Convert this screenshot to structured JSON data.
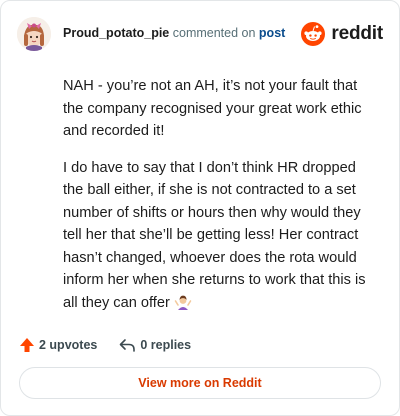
{
  "header": {
    "username": "Proud_potato_pie",
    "action_text": "commented on",
    "post_link": "post",
    "brand_word": "reddit"
  },
  "comment": {
    "paragraph_1": "NAH - you’re not an AH, it’s not your fault that the company recognised your great work ethic and recorded it!",
    "paragraph_2": "I do have to say that I don’t think HR dropped the ball either, if she is not contracted to a set number of shifts or hours then why would they tell her that she’ll be getting less! Her contract hasn’t changed, whoever does the rota would inform her when she returns to work that this is all they can offer"
  },
  "actions": {
    "upvotes": "2 upvotes",
    "replies": "0 replies"
  },
  "footer": {
    "view_more": "View more on Reddit"
  },
  "colors": {
    "reddit_orange": "#ff4500",
    "link_blue": "#0a4c8c",
    "upvote_red": "#ff4500",
    "view_more_text": "#d93a00"
  },
  "icons": {
    "avatar": "user-avatar",
    "brand": "reddit-snoo-icon",
    "emoji": "shrug-woman-emoji",
    "upvote": "upvote-arrow-icon",
    "reply": "reply-arrow-icon"
  }
}
